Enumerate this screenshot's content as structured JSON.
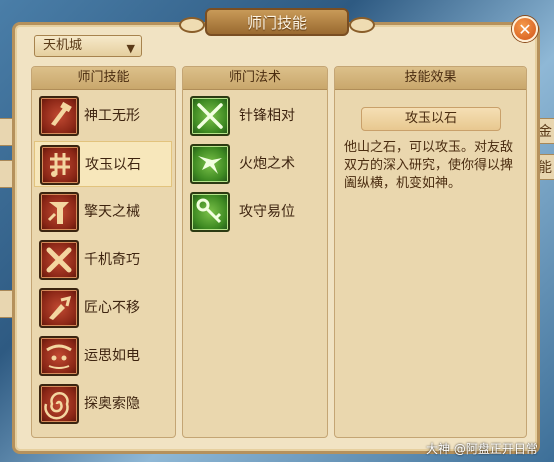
{
  "window": {
    "title": "师门技能",
    "close_label": "✕"
  },
  "faction_select": {
    "value": "天机城",
    "arrow": "▼"
  },
  "skills_column": {
    "header": "师门技能",
    "items": [
      {
        "label": "神工无形",
        "icon": "craft-hammer-icon"
      },
      {
        "label": "攻玉以石",
        "icon": "jade-stone-icon",
        "selected": true
      },
      {
        "label": "擎天之械",
        "icon": "pillar-mechanism-icon"
      },
      {
        "label": "千机奇巧",
        "icon": "crossed-tools-icon"
      },
      {
        "label": "匠心不移",
        "icon": "chisel-icon"
      },
      {
        "label": "运思如电",
        "icon": "thought-face-icon"
      },
      {
        "label": "探奥索隐",
        "icon": "spiral-vortex-icon"
      }
    ]
  },
  "arts_column": {
    "header": "师门法术",
    "items": [
      {
        "label": "针锋相对",
        "icon": "crossed-needles-icon"
      },
      {
        "label": "火炮之术",
        "icon": "cannon-beast-icon"
      },
      {
        "label": "攻守易位",
        "icon": "swap-key-icon"
      }
    ]
  },
  "effect_column": {
    "header": "技能效果",
    "skill_name": "攻玉以石",
    "description": "他山之石，可以攻玉。对友敌双方的深入研究，使你得以捭阖纵横，机变如神。"
  },
  "background": {
    "right_tab_1": "金",
    "right_tab_2": "能"
  },
  "watermark": "大神 @阿盘正开日常"
}
